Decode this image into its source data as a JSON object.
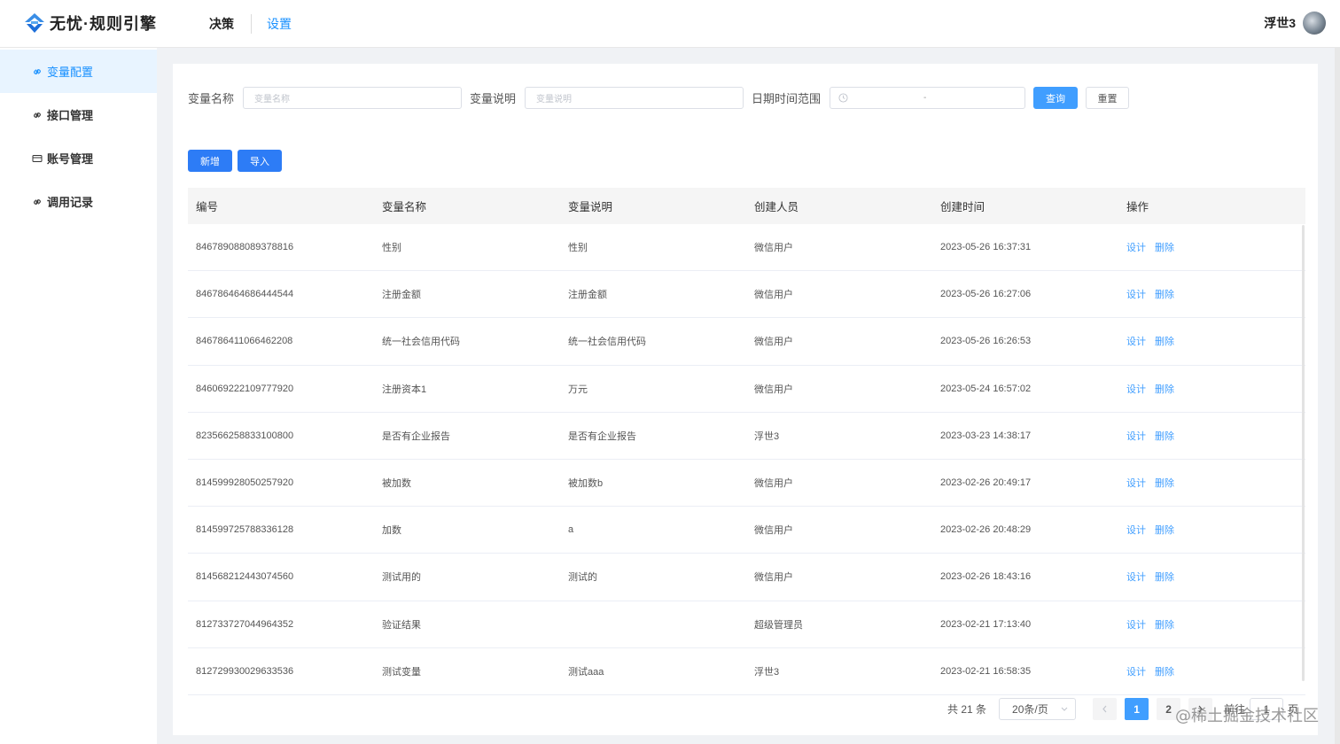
{
  "header": {
    "logo_text": "无忧·规则引擎",
    "nav": [
      {
        "label": "决策",
        "active": false
      },
      {
        "label": "设置",
        "active": true
      }
    ],
    "user_name": "浮世3"
  },
  "sidebar": {
    "items": [
      {
        "label": "变量配置",
        "icon": "link-icon",
        "active": true
      },
      {
        "label": "接口管理",
        "icon": "link-icon",
        "active": false
      },
      {
        "label": "账号管理",
        "icon": "card-icon",
        "active": false
      },
      {
        "label": "调用记录",
        "icon": "link-icon",
        "active": false
      }
    ]
  },
  "filters": {
    "name_label": "变量名称",
    "name_placeholder": "变量名称",
    "desc_label": "变量说明",
    "desc_placeholder": "变量说明",
    "date_label": "日期时间范围",
    "date_separator": "-",
    "query_label": "查询",
    "reset_label": "重置"
  },
  "actions": {
    "add_label": "新增",
    "import_label": "导入"
  },
  "table": {
    "columns": [
      "编号",
      "变量名称",
      "变量说明",
      "创建人员",
      "创建时间",
      "操作"
    ],
    "op_design": "设计",
    "op_delete": "删除",
    "rows": [
      {
        "id": "846789088089378816",
        "name": "性别",
        "desc": "性别",
        "creator": "微信用户",
        "time": "2023-05-26 16:37:31"
      },
      {
        "id": "846786464686444544",
        "name": "注册金额",
        "desc": "注册金额",
        "creator": "微信用户",
        "time": "2023-05-26 16:27:06"
      },
      {
        "id": "846786411066462208",
        "name": "统一社会信用代码",
        "desc": "统一社会信用代码",
        "creator": "微信用户",
        "time": "2023-05-26 16:26:53"
      },
      {
        "id": "846069222109777920",
        "name": "注册资本1",
        "desc": "万元",
        "creator": "微信用户",
        "time": "2023-05-24 16:57:02"
      },
      {
        "id": "823566258833100800",
        "name": "是否有企业报告",
        "desc": "是否有企业报告",
        "creator": "浮世3",
        "time": "2023-03-23 14:38:17"
      },
      {
        "id": "814599928050257920",
        "name": "被加数",
        "desc": "被加数b",
        "creator": "微信用户",
        "time": "2023-02-26 20:49:17"
      },
      {
        "id": "814599725788336128",
        "name": "加数",
        "desc": "a",
        "creator": "微信用户",
        "time": "2023-02-26 20:48:29"
      },
      {
        "id": "814568212443074560",
        "name": "测试用的",
        "desc": "测试的",
        "creator": "微信用户",
        "time": "2023-02-26 18:43:16"
      },
      {
        "id": "812733727044964352",
        "name": "验证结果",
        "desc": "",
        "creator": "超级管理员",
        "time": "2023-02-21 17:13:40"
      },
      {
        "id": "812729930029633536",
        "name": "测试变量",
        "desc": "测试aaa",
        "creator": "浮世3",
        "time": "2023-02-21 16:58:35"
      }
    ]
  },
  "pagination": {
    "total_text": "共 21 条",
    "page_size": "20条/页",
    "pages": [
      "1",
      "2"
    ],
    "current_page": "1",
    "prev_icon": "chevron-left-icon",
    "next_icon": "chevron-right-icon",
    "goto_label": "前往",
    "goto_value": "1",
    "page_suffix": "页"
  },
  "watermark": "@稀土掘金技术社区",
  "colors": {
    "accent": "#409eff",
    "sidebar_active_bg": "#e8f4ff"
  }
}
